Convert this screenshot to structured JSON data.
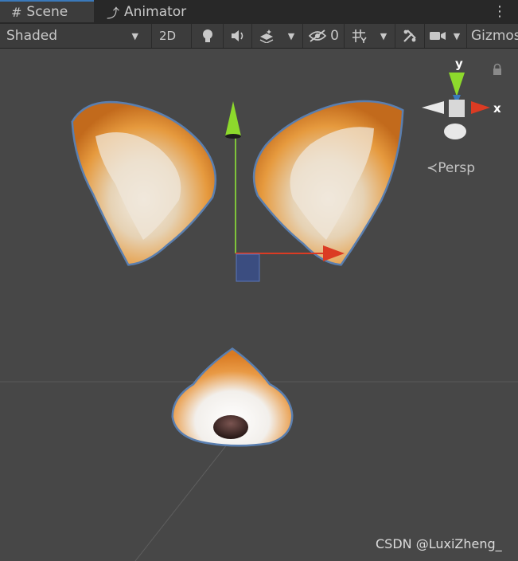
{
  "tabs": [
    {
      "label": "Scene",
      "icon": "hash-grid-icon"
    },
    {
      "label": "Animator",
      "icon": "animator-icon"
    }
  ],
  "toolbar": {
    "draw_mode": "Shaded",
    "mode_2d": "2D",
    "hidden_count": "0",
    "gizmos": "Gizmos"
  },
  "scene_gizmo": {
    "y_label": "y",
    "x_label": "x",
    "projection": "Persp"
  },
  "colors": {
    "accent": "#3a79bb",
    "x_axis": "#db3b23",
    "y_axis": "#8dd92c",
    "scene_bg": "#474747",
    "ear_orange": "#e68a24",
    "outline": "#5a7fb0"
  },
  "watermark": "CSDN @LuxiZheng_"
}
